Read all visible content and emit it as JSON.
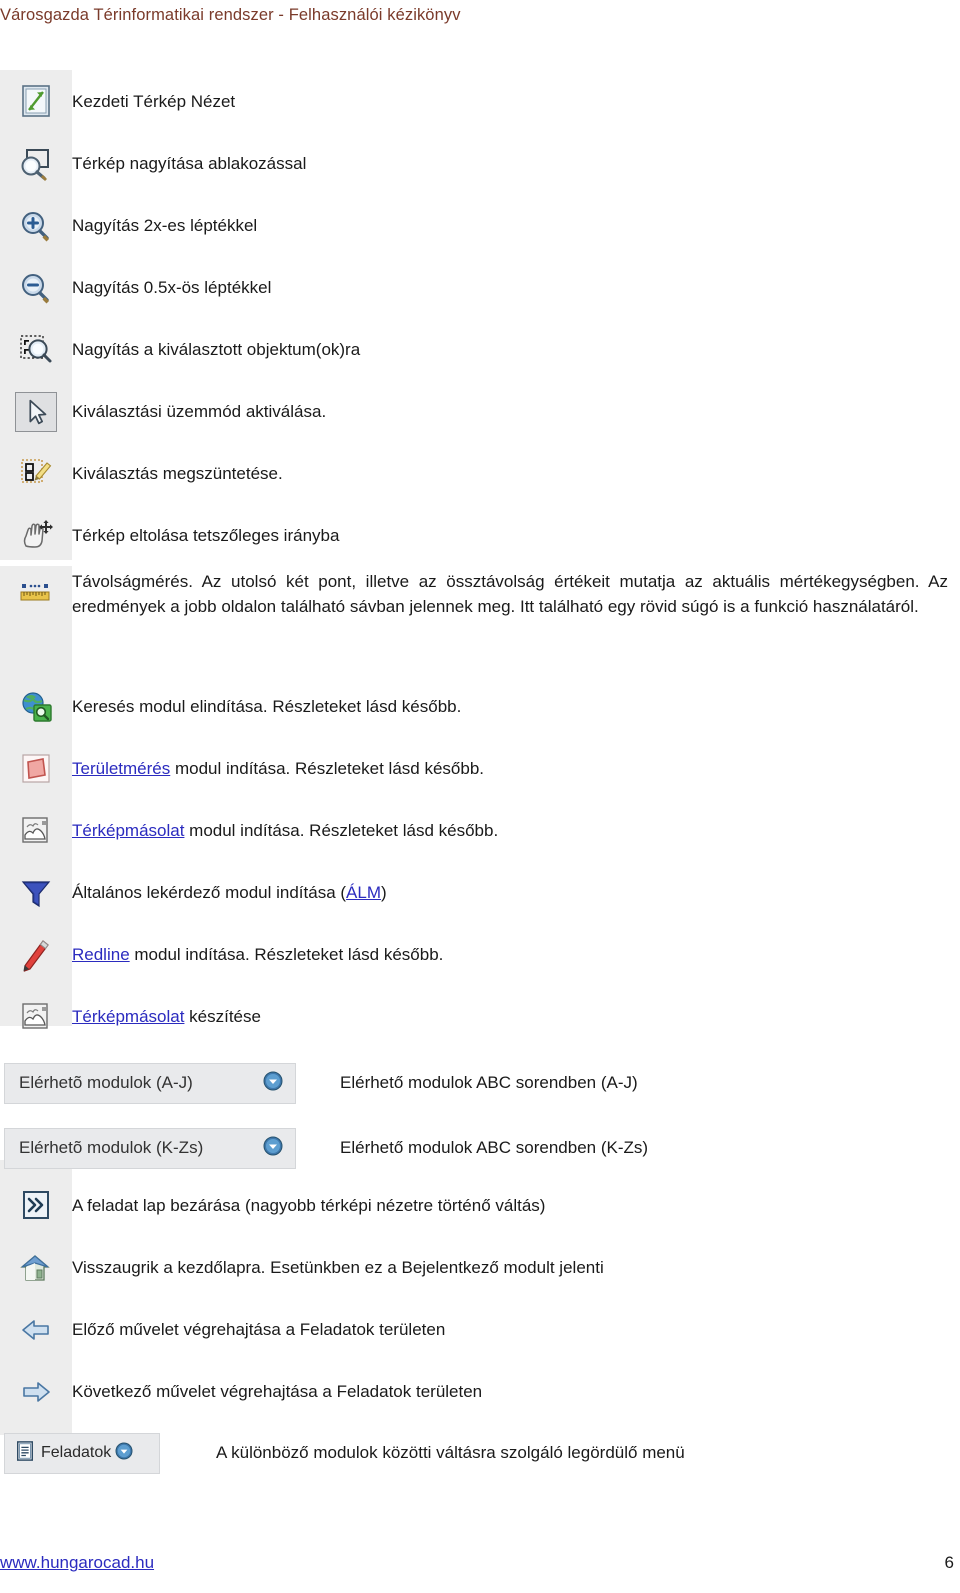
{
  "header": {
    "title": "Városgazda Térinformatikai rendszer - Felhasználói kézikönyv",
    "color": "#7a3a2a"
  },
  "footer": {
    "link": "www.hungarocad.hu",
    "page_number": "6",
    "link_color": "#2b2bbf"
  },
  "colors": {
    "link": "#2b2bbf",
    "icon_strip": "#ededed",
    "button_face": "#e9eaec",
    "text": "#1a1a1a"
  },
  "rows": [
    {
      "icon": "zoom-full-extent-icon",
      "text": "Kezdeti Térkép Nézet"
    },
    {
      "icon": "zoom-window-icon",
      "text": "Térkép nagyítása ablakozással"
    },
    {
      "icon": "zoom-in-icon",
      "text": "Nagyítás 2x-es léptékkel"
    },
    {
      "icon": "zoom-out-icon",
      "text": "Nagyítás 0.5x-ös léptékkel"
    },
    {
      "icon": "zoom-to-selection-icon",
      "text": "Nagyítás a kiválasztott objektum(ok)ra"
    },
    {
      "icon": "select-arrow-icon",
      "text": "Kiválasztási üzemmód aktiválása."
    },
    {
      "icon": "clear-selection-icon",
      "text": "Kiválasztás megszüntetése."
    },
    {
      "icon": "pan-hand-icon",
      "text": "Térkép eltolása tetszőleges irányba"
    },
    {
      "icon": "distance-measure-icon",
      "text": "Távolságmérés. Az utolsó két pont, illetve az össztávolság értékeit mutatja az aktuális mértékegységben. Az eredmények a jobb oldalon található sávban jelennek meg. Itt található egy rövid súgó is a funkció használatáról.",
      "justify": true
    },
    {
      "icon": "search-globe-icon",
      "text": "Keresés modul elindítása. Részleteket lásd később."
    },
    {
      "icon": "area-measure-icon",
      "link": "Területmérés",
      "text": " modul indítása. Részleteket lásd később."
    },
    {
      "icon": "map-copy-icon",
      "link": "Térképmásolat",
      "text": " modul indítása. Részleteket lásd később."
    },
    {
      "icon": "filter-funnel-icon",
      "text_before": "Általános lekérdező modul indítása (",
      "link": "ÁLM",
      "text_after": ")"
    },
    {
      "icon": "redline-pencil-icon",
      "link": "Redline",
      "text": " modul indítása. Részleteket lásd később."
    },
    {
      "icon": "map-copy-icon",
      "link": "Térképmásolat",
      "text": " készítése"
    }
  ],
  "dropdowns": [
    {
      "button_label": "Elérhetõ modulok (A-J)",
      "description": "Elérhető modulok ABC sorendben (A-J)",
      "chevron": "chevron-down-icon"
    },
    {
      "button_label": "Elérhetõ modulok (K-Zs)",
      "description": "Elérhető modulok ABC sorendben (K-Zs)",
      "chevron": "chevron-down-icon"
    }
  ],
  "rows_bottom": [
    {
      "icon": "close-task-panel-icon",
      "text": "A feladat lap bezárása (nagyobb térképi nézetre történő váltás)"
    },
    {
      "icon": "home-icon",
      "text": "Visszaugrik a kezdőlapra. Esetünkben ez a Bejelentkező modult jelenti"
    },
    {
      "icon": "arrow-left-icon",
      "text": "Előző művelet végrehajtása a Feladatok területen"
    },
    {
      "icon": "arrow-right-icon",
      "text": "Következő művelet végrehajtása a Feladatok területen"
    }
  ],
  "tasks_dropdown": {
    "icon": "task-list-icon",
    "button_label": "Feladatok",
    "chevron": "chevron-down-icon",
    "description": "A különböző modulok közötti váltásra szolgáló legördülő menü"
  }
}
